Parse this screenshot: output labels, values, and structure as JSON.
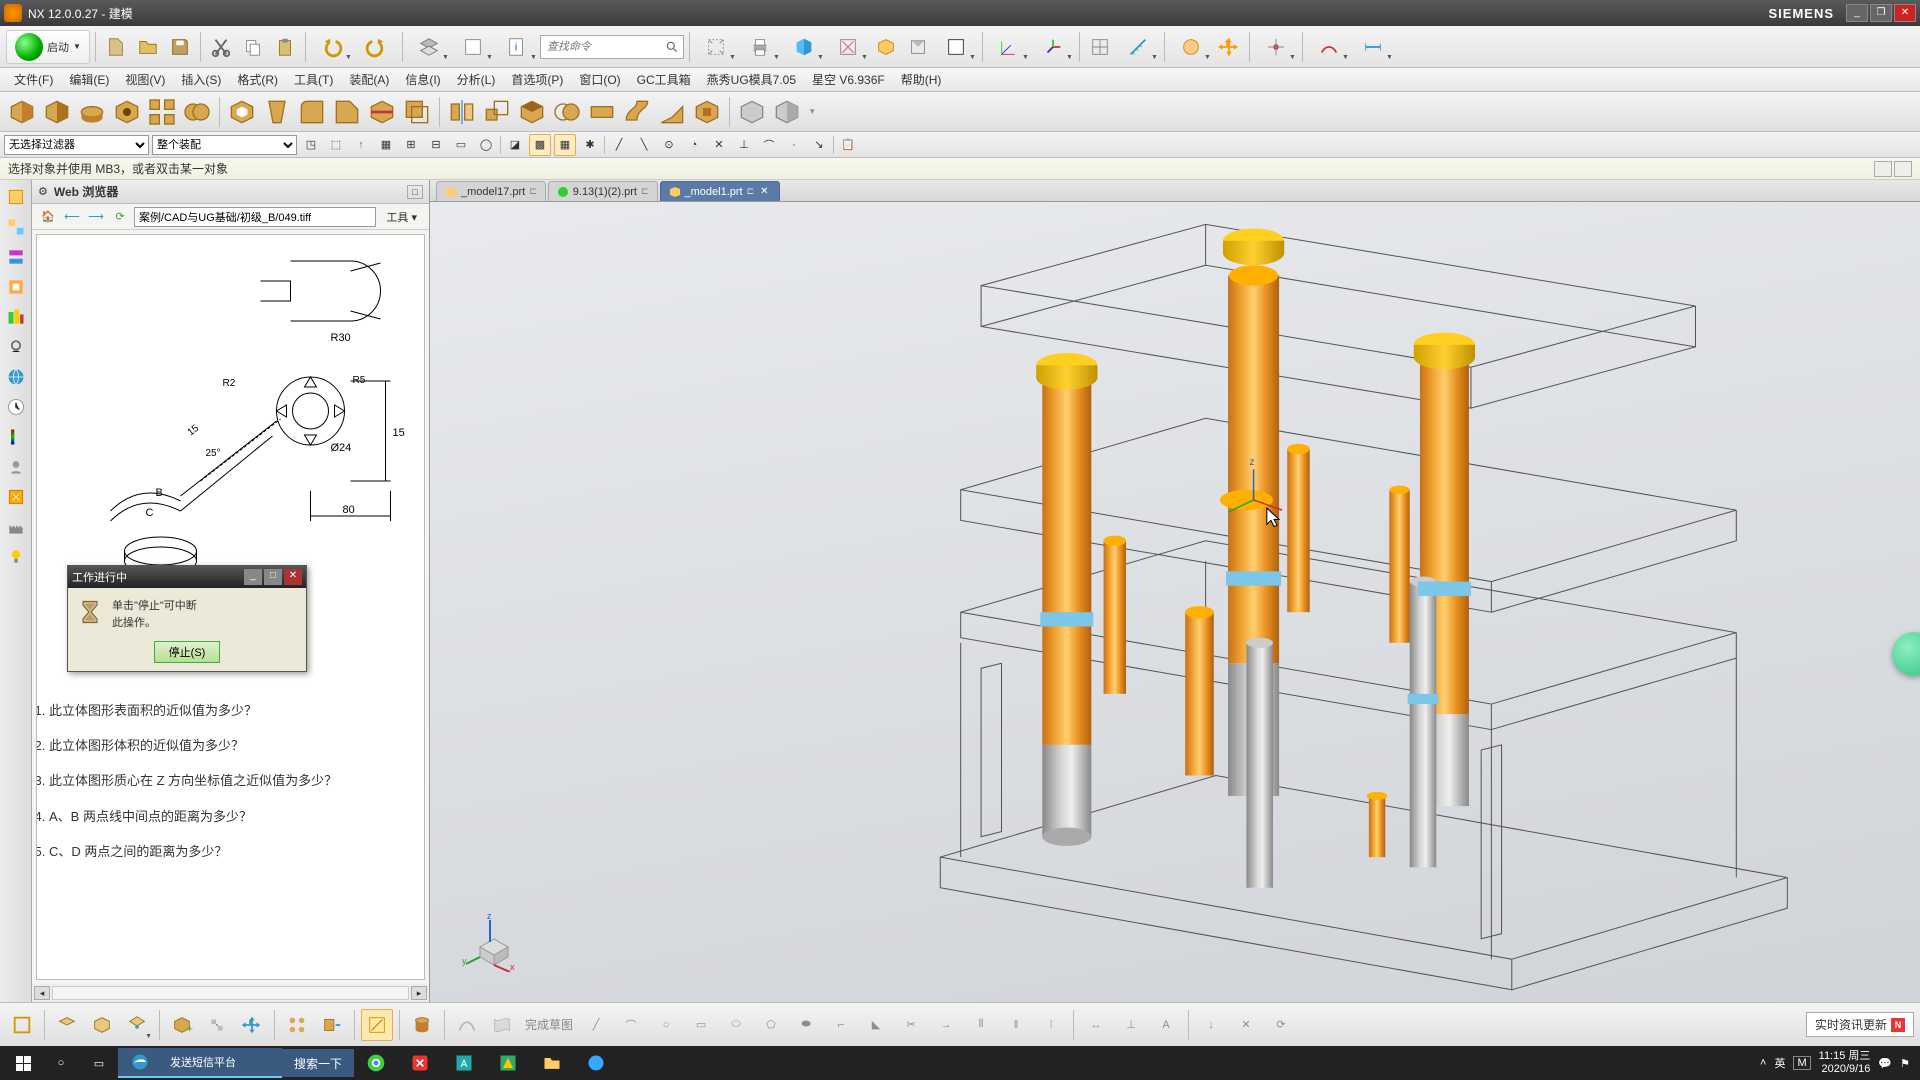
{
  "titlebar": {
    "title": "NX 12.0.0.27 - 建模",
    "brand": "SIEMENS"
  },
  "ribbon": {
    "start_label": "启动",
    "search_placeholder": "查找命令"
  },
  "menu": {
    "items": [
      "文件(F)",
      "编辑(E)",
      "视图(V)",
      "插入(S)",
      "格式(R)",
      "工具(T)",
      "装配(A)",
      "信息(I)",
      "分析(L)",
      "首选项(P)",
      "窗口(O)",
      "GC工具箱",
      "燕秀UG模具7.05",
      "星空  V6.936F",
      "帮助(H)"
    ]
  },
  "selection": {
    "filter1": "无选择过滤器",
    "filter2": "整个装配"
  },
  "hint": {
    "text": "选择对象并使用 MB3，或者双击某一对象"
  },
  "webpanel": {
    "title": "Web 浏览器",
    "url": "案例/CAD与UG基础/初级_B/049.tiff",
    "tools_label": "工具",
    "questions": [
      "此立体图形表面积的近似值为多少？",
      "此立体图形体积的近似值为多少？",
      "此立体图形质心在 Z 方向坐标值之近似值为多少？",
      "A、B 两点线中间点的距离为多少？",
      "C、D 两点之间的距离为多少？"
    ]
  },
  "dialog": {
    "title": "工作进行中",
    "message_l1": "单击\"停止\"可中断",
    "message_l2": "此操作。",
    "stop_btn": "停止(S)"
  },
  "tabs": [
    {
      "label": "_model17.prt",
      "active": false,
      "closable": false
    },
    {
      "label": "9.13(1)(2).prt",
      "active": false,
      "closable": false
    },
    {
      "label": "_model1.prt",
      "active": true,
      "closable": true
    }
  ],
  "triad": {
    "x": "x",
    "y": "y",
    "z": "z"
  },
  "bottombar": {
    "finish_sketch": "完成草图",
    "news": "实时资讯更新"
  },
  "taskbar": {
    "app_label": "发送短信平台",
    "search_label": "搜索一下",
    "ime": "英",
    "layout": "M",
    "time": "11:15",
    "weekday": "周三",
    "date": "2020/9/16"
  },
  "drawing": {
    "r30": "R30",
    "r2": "R2",
    "r5": "R5",
    "d24": "Ø24",
    "d15": "15",
    "a25": "25°",
    "w80": "80",
    "h15": "15",
    "pB": "B",
    "pC": "C"
  }
}
